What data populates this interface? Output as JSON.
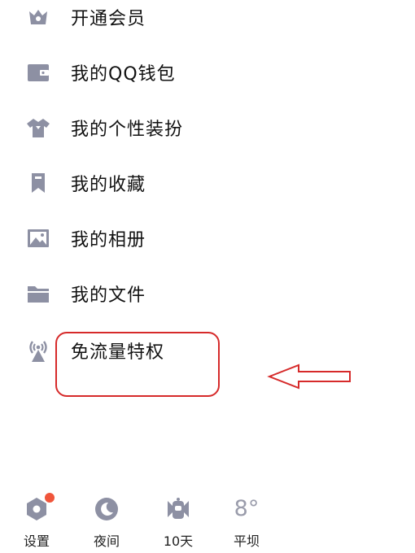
{
  "menu": {
    "items": [
      {
        "label": "开通会员",
        "icon": "crown-icon"
      },
      {
        "label": "我的QQ钱包",
        "icon": "wallet-icon"
      },
      {
        "label": "我的个性装扮",
        "icon": "shirt-icon"
      },
      {
        "label": "我的收藏",
        "icon": "bookmark-icon"
      },
      {
        "label": "我的相册",
        "icon": "photo-icon"
      },
      {
        "label": "我的文件",
        "icon": "folder-icon"
      },
      {
        "label": "免流量特权",
        "icon": "antenna-icon"
      }
    ]
  },
  "bottom_bar": {
    "settings_label": "设置",
    "night_label": "夜间",
    "weather_days_label": "10天",
    "temperature": "8°",
    "location_label": "平坝"
  },
  "colors": {
    "icon": "#8d90a3",
    "annotation": "#d62a2a",
    "badge": "#f0553b"
  }
}
